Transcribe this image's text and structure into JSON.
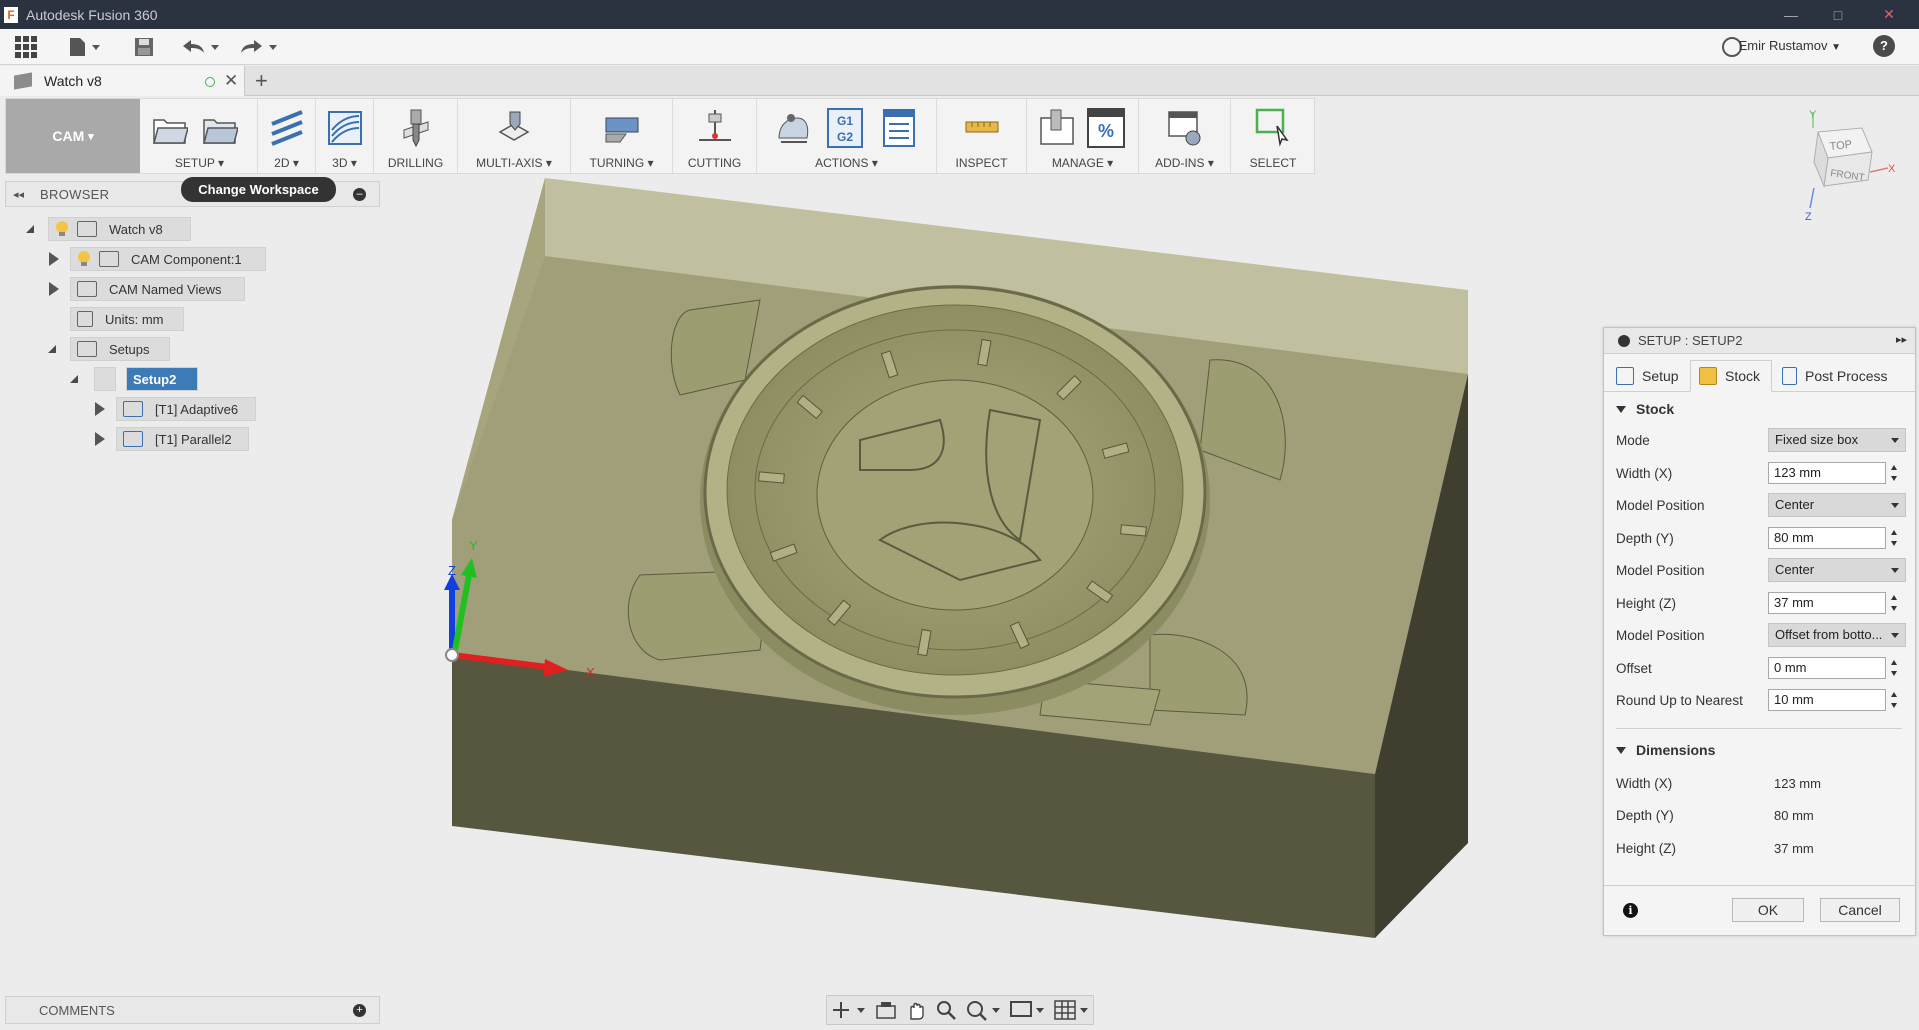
{
  "window": {
    "title": "Autodesk Fusion 360",
    "logo_letter": "F",
    "min_glyph": "—",
    "max_glyph": "□",
    "close_glyph": "✕"
  },
  "quickbar": {
    "user_name": "Emir Rustamov",
    "user_caret": "▼",
    "help_label": "?"
  },
  "tab": {
    "document_name": "Watch v8",
    "close_glyph": "✕",
    "new_tab_glyph": "+"
  },
  "ribbon": {
    "workspace": "CAM",
    "workspace_caret": "▾",
    "groups": [
      {
        "label": "SETUP",
        "caret": true
      },
      {
        "label": "2D",
        "caret": true
      },
      {
        "label": "3D",
        "caret": true
      },
      {
        "label": "DRILLING",
        "caret": false
      },
      {
        "label": "MULTI-AXIS",
        "caret": true
      },
      {
        "label": "TURNING",
        "caret": true
      },
      {
        "label": "CUTTING",
        "caret": false
      },
      {
        "label": "ACTIONS",
        "caret": true
      },
      {
        "label": "INSPECT",
        "caret": false
      },
      {
        "label": "MANAGE",
        "caret": true
      },
      {
        "label": "ADD-INS",
        "caret": true
      },
      {
        "label": "SELECT",
        "caret": false
      }
    ],
    "g1g2_icon_text": [
      "G1",
      "G2"
    ],
    "percent_icon_text": "%"
  },
  "tooltip": "Change Workspace",
  "browser": {
    "title": "BROWSER",
    "collapse_glyph": "◂◂",
    "minus_glyph": "–",
    "items": [
      {
        "label": "Watch v8"
      },
      {
        "label": "CAM Component:1"
      },
      {
        "label": "CAM Named Views"
      },
      {
        "label": "Units: mm"
      },
      {
        "label": "Setups"
      },
      {
        "label": "Setup2"
      },
      {
        "label": "[T1] Adaptive6"
      },
      {
        "label": "[T1] Parallel2"
      }
    ]
  },
  "comments": {
    "title": "COMMENTS",
    "plus_glyph": "+"
  },
  "viewcube": {
    "top": "TOP",
    "front": "FRONT",
    "x": "X",
    "y": "Y",
    "z": "Z"
  },
  "triad": {
    "x": "X",
    "y": "Y",
    "z": "Z"
  },
  "dialog": {
    "title": "SETUP : SETUP2",
    "expand_glyph": "▸▸",
    "tabs": [
      "Setup",
      "Stock",
      "Post Process"
    ],
    "stock_section": "Stock",
    "fields": [
      {
        "label": "Mode",
        "value": "Fixed size box",
        "kind": "select"
      },
      {
        "label": "Width (X)",
        "value": "123 mm",
        "kind": "input"
      },
      {
        "label": "Model Position",
        "value": "Center",
        "kind": "select"
      },
      {
        "label": "Depth (Y)",
        "value": "80 mm",
        "kind": "input"
      },
      {
        "label": "Model Position",
        "value": "Center",
        "kind": "select"
      },
      {
        "label": "Height (Z)",
        "value": "37 mm",
        "kind": "input"
      },
      {
        "label": "Model Position",
        "value": "Offset from botto...",
        "kind": "select"
      },
      {
        "label": "Offset",
        "value": "0 mm",
        "kind": "input"
      },
      {
        "label": "Round Up to Nearest",
        "value": "10 mm",
        "kind": "input"
      }
    ],
    "dimensions_section": "Dimensions",
    "dimensions": [
      {
        "label": "Width (X)",
        "value": "123 mm"
      },
      {
        "label": "Depth (Y)",
        "value": "80 mm"
      },
      {
        "label": "Height (Z)",
        "value": "37 mm"
      }
    ],
    "info_glyph": "i",
    "ok_label": "OK",
    "cancel_label": "Cancel"
  },
  "colors": {
    "titlebar": "#2b3340",
    "selection": "#3d7ab8",
    "stock_body": "#8a8a5c",
    "part": "#a4a47a",
    "axis_x": "#e02020",
    "axis_y": "#20c020",
    "axis_z": "#1040e0"
  }
}
